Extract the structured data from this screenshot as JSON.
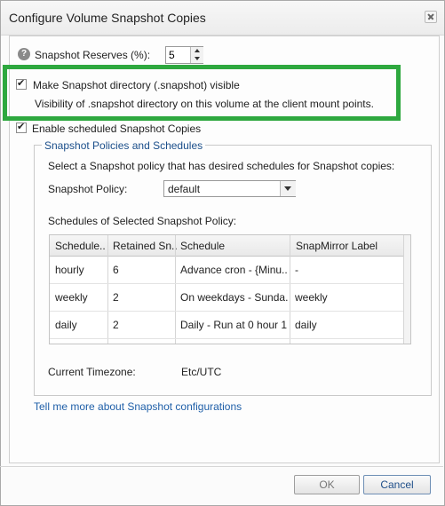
{
  "dialog": {
    "title": "Configure Volume Snapshot Copies",
    "close_icon": "close-icon"
  },
  "reserves": {
    "help_icon": "question-icon",
    "help_glyph": "?",
    "label": "Snapshot Reserves (%):",
    "value": "5"
  },
  "visible_dir": {
    "checked": true,
    "label": "Make Snapshot directory (.snapshot) visible",
    "description": "Visibility of .snapshot directory on this volume at the client mount points."
  },
  "scheduled": {
    "checked": true,
    "label": "Enable scheduled Snapshot Copies"
  },
  "policies": {
    "legend": "Snapshot Policies and Schedules",
    "instruction": "Select a Snapshot policy that has desired schedules for Snapshot copies:",
    "policy_label": "Snapshot Policy:",
    "policy_value": "default",
    "schedules_label": "Schedules of Selected Snapshot Policy:",
    "columns": [
      "Schedule...",
      "Retained Sn...",
      "Schedule",
      "SnapMirror Label"
    ],
    "rows": [
      [
        "hourly",
        "6",
        "Advance cron - {Minu...",
        "-"
      ],
      [
        "weekly",
        "2",
        "On weekdays - Sunda...",
        "weekly"
      ],
      [
        "daily",
        "2",
        "Daily - Run at 0 hour 1...",
        "daily"
      ]
    ],
    "timezone_label": "Current Timezone:",
    "timezone_value": "Etc/UTC"
  },
  "link_text": "Tell me more about Snapshot configurations",
  "buttons": {
    "ok": "OK",
    "cancel": "Cancel"
  },
  "colors": {
    "highlight": "#2ea83f",
    "link": "#1f5fa8",
    "legend": "#1a4e8a"
  }
}
